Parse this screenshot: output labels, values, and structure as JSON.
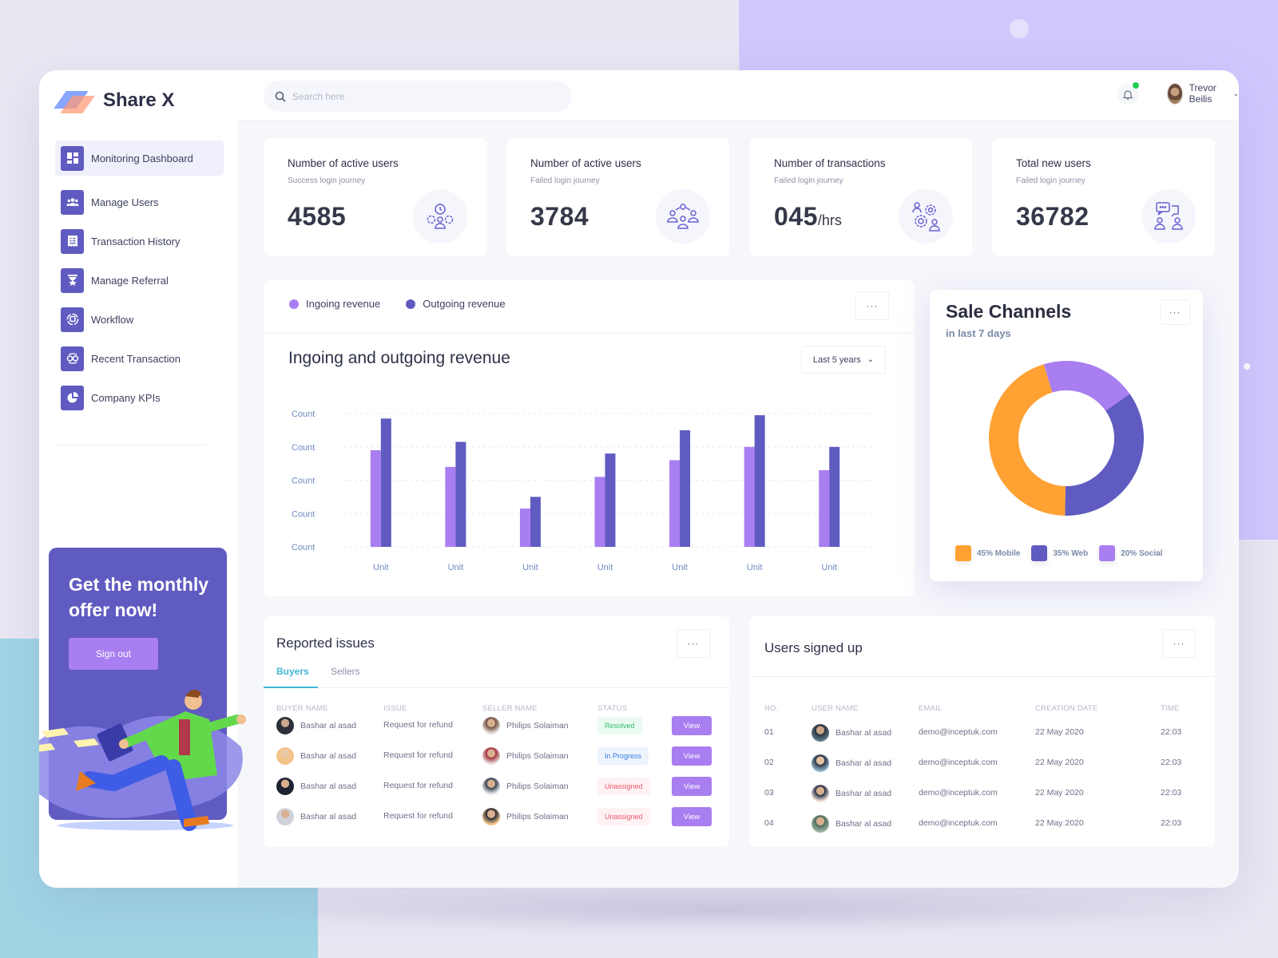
{
  "app": {
    "name": "Share X"
  },
  "sidebar": {
    "items": [
      {
        "label": "Monitoring Dashboard",
        "icon": "dashboard-grid-icon",
        "active": true
      },
      {
        "label": "Manage Users",
        "icon": "users-icon",
        "active": false
      },
      {
        "label": "Transaction History",
        "icon": "receipt-icon",
        "active": false
      },
      {
        "label": "Manage Referral",
        "icon": "award-badge-icon",
        "active": false
      },
      {
        "label": "Workflow",
        "icon": "workflow-icon",
        "active": false
      },
      {
        "label": "Recent Transaction",
        "icon": "exchange-icon",
        "active": false
      },
      {
        "label": "Company KPIs",
        "icon": "pie-chart-icon",
        "active": false
      }
    ],
    "promo": {
      "title": "Get the monthly offer now!",
      "button": "Sign out"
    }
  },
  "header": {
    "search_placeholder": "Search here",
    "user_name": "Trevor Beilis",
    "notification_dot": true
  },
  "kpis": [
    {
      "title": "Number of active users",
      "subtitle": "Success login journey",
      "value": "4585",
      "unit": "",
      "icon": "gears-user-icon"
    },
    {
      "title": "Number of active users",
      "subtitle": "Failed login journey",
      "value": "3784",
      "unit": "",
      "icon": "user-group-icon"
    },
    {
      "title": "Number of transactions",
      "subtitle": "Failed login journey",
      "value": "045",
      "unit": "/hrs",
      "icon": "gear-users-icon"
    },
    {
      "title": "Total new users",
      "subtitle": "Failed login journey",
      "value": "36782",
      "unit": "",
      "icon": "chat-users-icon"
    }
  ],
  "revenue": {
    "legend": [
      {
        "label": "Ingoing revenue",
        "color": "#a97ef0"
      },
      {
        "label": "Outgoing revenue",
        "color": "#605bc1"
      }
    ],
    "title": "Ingoing and outgoing revenue",
    "period": "Last 5 years",
    "more": "···"
  },
  "sale_channels": {
    "title": "Sale Channels",
    "subtitle": "in last 7 days",
    "more": "···",
    "legend": [
      {
        "label": "45% Mobile",
        "color": "#ffa133"
      },
      {
        "label": "35% Web",
        "color": "#605bc1"
      },
      {
        "label": "20% Social",
        "color": "#a97ef0"
      }
    ]
  },
  "chart_data": [
    {
      "type": "bar",
      "title": "Ingoing and outgoing revenue",
      "xlabel": "",
      "ylabel": "",
      "categories": [
        "Unit",
        "Unit",
        "Unit",
        "Unit",
        "Unit",
        "Unit",
        "Unit"
      ],
      "y_tick_labels": [
        "Count",
        "Count",
        "Count",
        "Count",
        "Count"
      ],
      "ylim": [
        0,
        4
      ],
      "grid": true,
      "legend": "top-left",
      "series": [
        {
          "name": "Ingoing revenue",
          "color": "#a97ef0",
          "values": [
            2.9,
            2.4,
            1.15,
            2.1,
            2.6,
            3.0,
            2.3
          ]
        },
        {
          "name": "Outgoing revenue",
          "color": "#605bc1",
          "values": [
            3.85,
            3.15,
            1.5,
            2.8,
            3.5,
            3.95,
            3.0
          ]
        }
      ]
    },
    {
      "type": "pie",
      "title": "Sale Channels",
      "subtitle": "in last 7 days",
      "donut": true,
      "legend": "bottom",
      "slices": [
        {
          "label": "Mobile",
          "value": 45,
          "color": "#ffa133"
        },
        {
          "label": "Web",
          "value": 35,
          "color": "#605bc1"
        },
        {
          "label": "Social",
          "value": 20,
          "color": "#a97ef0"
        }
      ]
    }
  ],
  "reported_issues": {
    "title": "Reported issues",
    "more": "···",
    "tabs": [
      {
        "label": "Buyers",
        "active": true
      },
      {
        "label": "Sellers",
        "active": false
      }
    ],
    "columns": [
      "BUYER NAME",
      "ISSUE",
      "SELLER NAME",
      "STATUS"
    ],
    "rows": [
      {
        "buyer": "Bashar al asad",
        "issue": "Request for refund",
        "seller": "Philips Solaiman",
        "status": "Resolved",
        "action": "View"
      },
      {
        "buyer": "Bashar al asad",
        "issue": "Request for refund",
        "seller": "Philips Solaiman",
        "status": "In Progress",
        "action": "View"
      },
      {
        "buyer": "Bashar al asad",
        "issue": "Request for refund",
        "seller": "Philips Solaiman",
        "status": "Unassigned",
        "action": "View"
      },
      {
        "buyer": "Bashar al asad",
        "issue": "Request for refund",
        "seller": "Philips Solaiman",
        "status": "Unassigned",
        "action": "View"
      }
    ],
    "status_colors": {
      "Resolved": {
        "fg": "#2fbf6a",
        "bg": "#ecfbf2"
      },
      "In Progress": {
        "fg": "#3a7ee6",
        "bg": "#eef4fd"
      },
      "Unassigned": {
        "fg": "#f0566c",
        "bg": "#fef2f4"
      }
    }
  },
  "users_signed_up": {
    "title": "Users signed up",
    "more": "···",
    "columns": [
      "NO.",
      "USER NAME",
      "EMAIL",
      "CREATION DATE",
      "TIME"
    ],
    "rows": [
      {
        "no": "01",
        "name": "Bashar al asad",
        "email": "demo@inceptuk.com",
        "date": "22 May 2020",
        "time": "22:03"
      },
      {
        "no": "02",
        "name": "Bashar al asad",
        "email": "demo@inceptuk.com",
        "date": "22 May 2020",
        "time": "22:03"
      },
      {
        "no": "03",
        "name": "Bashar al asad",
        "email": "demo@inceptuk.com",
        "date": "22 May 2020",
        "time": "22:03"
      },
      {
        "no": "04",
        "name": "Bashar al asad",
        "email": "demo@inceptuk.com",
        "date": "22 May 2020",
        "time": "22:03"
      }
    ]
  }
}
